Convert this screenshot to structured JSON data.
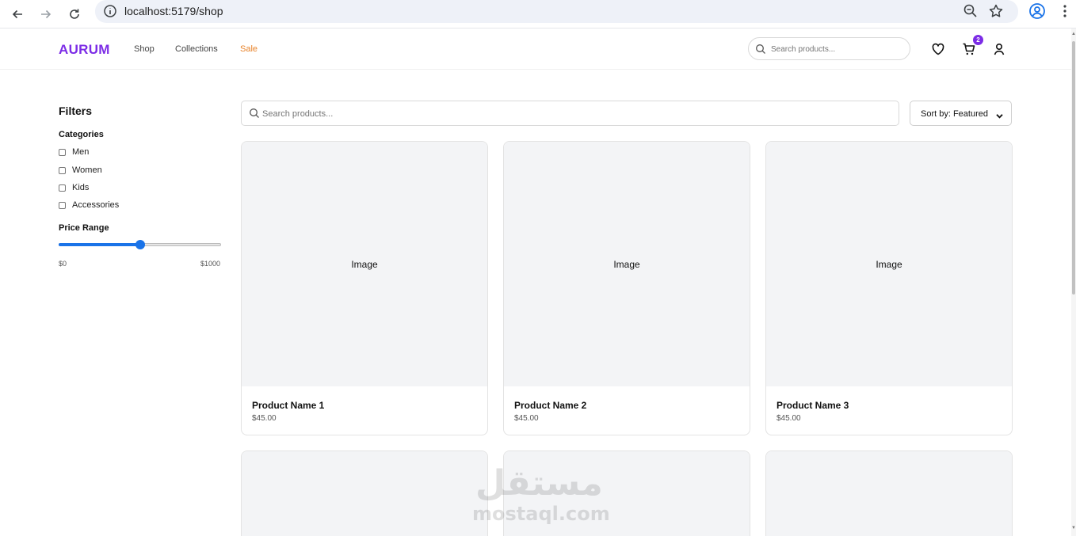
{
  "browser": {
    "url": "localhost:5179/shop"
  },
  "header": {
    "logo": "AURUM",
    "nav": [
      {
        "label": "Shop"
      },
      {
        "label": "Collections"
      },
      {
        "label": "Sale"
      }
    ],
    "search_placeholder": "Search products...",
    "cart_count": "2"
  },
  "filters": {
    "title": "Filters",
    "categories_title": "Categories",
    "categories": [
      {
        "label": "Men",
        "checked": false
      },
      {
        "label": "Women",
        "checked": false
      },
      {
        "label": "Kids",
        "checked": false
      },
      {
        "label": "Accessories",
        "checked": false
      }
    ],
    "price_title": "Price Range",
    "price_min": "$0",
    "price_max": "$1000",
    "price_value_fraction": 0.5
  },
  "main": {
    "search_placeholder": "Search products...",
    "sort_label": "Sort by: Featured"
  },
  "products": [
    {
      "image": "Image",
      "name": "Product Name 1",
      "price": "$45.00"
    },
    {
      "image": "Image",
      "name": "Product Name 2",
      "price": "$45.00"
    },
    {
      "image": "Image",
      "name": "Product Name 3",
      "price": "$45.00"
    }
  ],
  "watermark": {
    "arabic": "مستقل",
    "latin": "mostaql.com"
  },
  "colors": {
    "brand": "#7c2ce6",
    "sale": "#e8832a",
    "slider": "#1a73e8"
  }
}
